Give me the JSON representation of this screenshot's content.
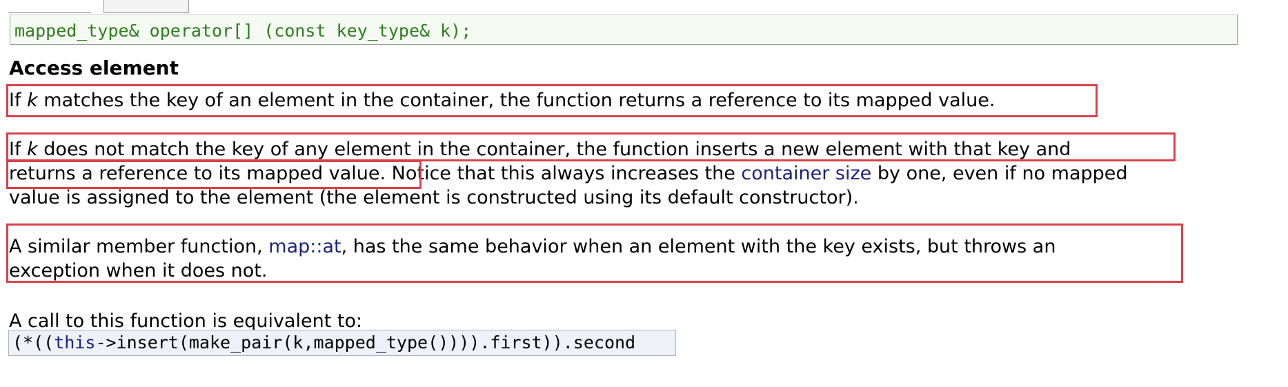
{
  "prototype": {
    "signature": "mapped_type& operator[] (const key_type& k);"
  },
  "section": {
    "heading": "Access element"
  },
  "paragraphs": {
    "p1": {
      "before": "If ",
      "param": "k",
      "after": " matches the key of an element in the container, the function returns a reference to its mapped value."
    },
    "p2": {
      "line1_before": "If ",
      "line1_param": "k",
      "line1_after": " does not match the key of any element in the container, the function inserts a new element with that key and",
      "line2_highlight": "returns a reference to its mapped value.",
      "line2_before_link": " Notice that this always increases the ",
      "line2_link": "container size",
      "line2_after_link": " by one, even if no mapped",
      "line3": "value is assigned to the element (the element is constructed using its default constructor)."
    },
    "p3": {
      "line1_before": "A similar member function, ",
      "line1_link": "map::at",
      "line1_after": ", has the same behavior when an element with the key exists, but throws an",
      "line2": "exception when it does not."
    },
    "p4": {
      "text": "A call to this function is equivalent to:"
    }
  },
  "equivalent_code": {
    "prefix": "(*((",
    "keyword": "this",
    "suffix": "->insert(make_pair(k,mapped_type()))).first)).second"
  },
  "colors": {
    "annotation_red": "#d9414a",
    "link_blue": "#1a237e",
    "prototype_green": "#2e7d1e"
  }
}
